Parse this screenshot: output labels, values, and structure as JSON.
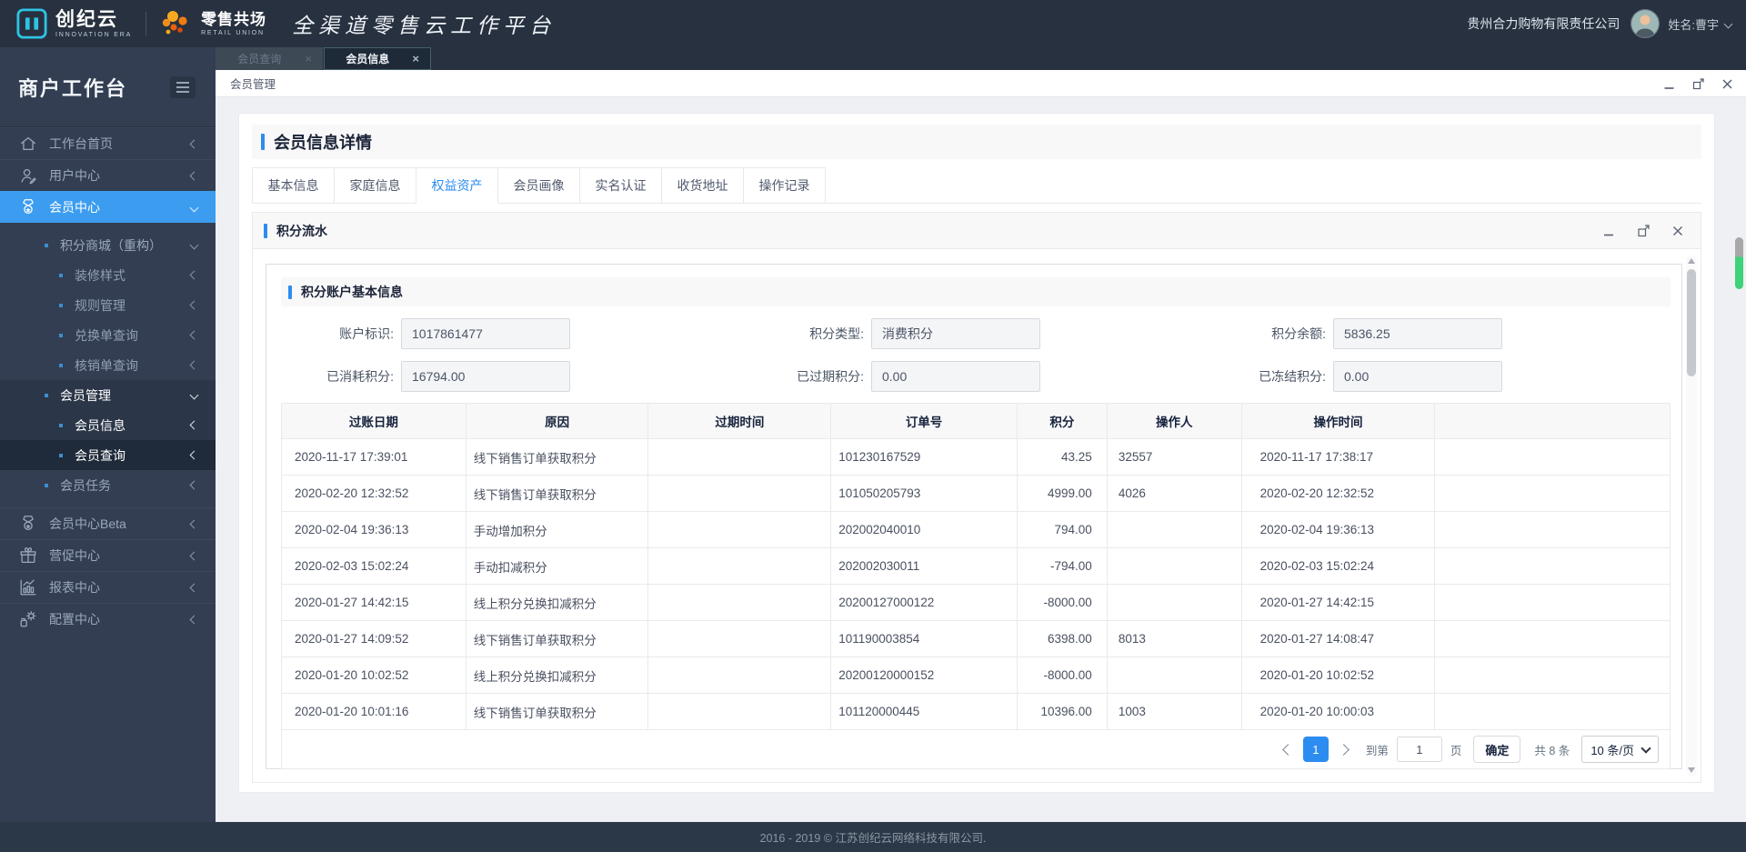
{
  "theme": {
    "accent": "#2d8cf0",
    "sidebar_active": "#3c9df0",
    "header_bg": "#27313f",
    "sidebar_bg": "#333e52",
    "footer_bg": "#2b3848",
    "logo_cyan": "#2fc3e4",
    "logo_orange": "#f08c1e",
    "scroll_green": "#3ed37a"
  },
  "header": {
    "brand_name": "创纪云",
    "brand_sub": "INNOVATION ERA",
    "partner_name": "零售共场",
    "partner_sub": "RETAIL UNION",
    "platform_title": "全渠道零售云工作平台",
    "company": "贵州合力购物有限责任公司",
    "user_name": "姓名:曹宇"
  },
  "tabs_bar": {
    "tabs": [
      {
        "label": "会员查询",
        "active": false
      },
      {
        "label": "会员信息",
        "active": true
      }
    ]
  },
  "breadcrumb": "会员管理",
  "sidebar": {
    "title": "商户工作台",
    "items": [
      {
        "label": "工作台首页",
        "level": 1,
        "icon": "home",
        "chevron": "left"
      },
      {
        "label": "用户中心",
        "level": 1,
        "icon": "user",
        "chevron": "left"
      },
      {
        "label": "会员中心",
        "level": 1,
        "icon": "medal",
        "chevron": "down",
        "state": "active-blue"
      },
      {
        "label": "积分商城（重构）",
        "level": 2,
        "chevron": "down",
        "gap_before": true
      },
      {
        "label": "装修样式",
        "level": 3,
        "chevron": "left"
      },
      {
        "label": "规则管理",
        "level": 3,
        "chevron": "left"
      },
      {
        "label": "兑换单查询",
        "level": 3,
        "chevron": "left"
      },
      {
        "label": "核销单查询",
        "level": 3,
        "chevron": "left"
      },
      {
        "label": "会员管理",
        "level": 2,
        "chevron": "down",
        "state": "selected"
      },
      {
        "label": "会员信息",
        "level": 3,
        "chevron": "left",
        "state": "selected"
      },
      {
        "label": "会员查询",
        "level": 3,
        "chevron": "left",
        "state": "selected-dark"
      },
      {
        "label": "会员任务",
        "level": 2,
        "chevron": "left"
      },
      {
        "label": "会员中心Beta",
        "level": 1,
        "icon": "medal",
        "chevron": "left",
        "gap_before": true
      },
      {
        "label": "营促中心",
        "level": 1,
        "icon": "gift",
        "chevron": "left"
      },
      {
        "label": "报表中心",
        "level": 1,
        "icon": "chart",
        "chevron": "left"
      },
      {
        "label": "配置中心",
        "level": 1,
        "icon": "config",
        "chevron": "left"
      }
    ]
  },
  "main": {
    "page_title": "会员信息详情",
    "tabs": [
      "基本信息",
      "家庭信息",
      "权益资产",
      "会员画像",
      "实名认证",
      "收货地址",
      "操作记录"
    ],
    "active_tab": "权益资产",
    "panel": {
      "title": "积分流水",
      "section_title": "积分账户基本信息",
      "fields": [
        {
          "label": "账户标识:",
          "value": "1017861477"
        },
        {
          "label": "积分类型:",
          "value": "消费积分"
        },
        {
          "label": "积分余额:",
          "value": "5836.25"
        },
        {
          "label": "已消耗积分:",
          "value": "16794.00"
        },
        {
          "label": "已过期积分:",
          "value": "0.00"
        },
        {
          "label": "已冻结积分:",
          "value": "0.00"
        }
      ],
      "table": {
        "columns": [
          "过账日期",
          "原因",
          "过期时间",
          "订单号",
          "积分",
          "操作人",
          "操作时间"
        ],
        "rows": [
          [
            "2020-11-17 17:39:01",
            "线下销售订单获取积分",
            "",
            "101230167529",
            "43.25",
            "32557",
            "2020-11-17 17:38:17"
          ],
          [
            "2020-02-20 12:32:52",
            "线下销售订单获取积分",
            "",
            "101050205793",
            "4999.00",
            "4026",
            "2020-02-20 12:32:52"
          ],
          [
            "2020-02-04 19:36:13",
            "手动增加积分",
            "",
            "202002040010",
            "794.00",
            "",
            "2020-02-04 19:36:13"
          ],
          [
            "2020-02-03 15:02:24",
            "手动扣减积分",
            "",
            "202002030011",
            "-794.00",
            "",
            "2020-02-03 15:02:24"
          ],
          [
            "2020-01-27 14:42:15",
            "线上积分兑换扣减积分",
            "",
            "20200127000122",
            "-8000.00",
            "",
            "2020-01-27 14:42:15"
          ],
          [
            "2020-01-27 14:09:52",
            "线下销售订单获取积分",
            "",
            "101190003854",
            "6398.00",
            "8013",
            "2020-01-27 14:08:47"
          ],
          [
            "2020-01-20 10:02:52",
            "线上积分兑换扣减积分",
            "",
            "20200120000152",
            "-8000.00",
            "",
            "2020-01-20 10:02:52"
          ],
          [
            "2020-01-20 10:01:16",
            "线下销售订单获取积分",
            "",
            "101120000445",
            "10396.00",
            "1003",
            "2020-01-20 10:00:03"
          ]
        ]
      },
      "pagination": {
        "current_page": "1",
        "goto_label": "到第",
        "goto_value": "1",
        "page_label": "页",
        "confirm_label": "确定",
        "total_label": "共 8 条",
        "page_size": "10 条/页"
      }
    }
  },
  "footer": "2016 - 2019 © 江苏创纪云网络科技有限公司."
}
